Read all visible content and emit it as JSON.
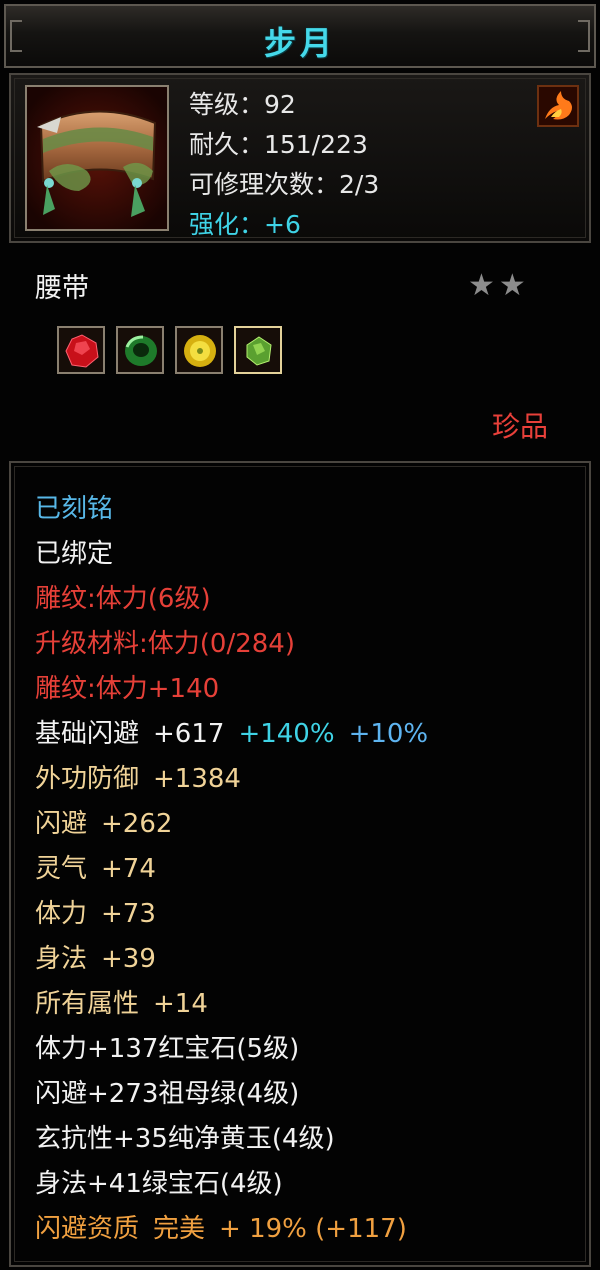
{
  "title": "步月",
  "header_stats": {
    "level": "等级：92",
    "durability": "耐久：151/223",
    "repair": "可修理次数：2/3",
    "enhance": "强化：+6"
  },
  "item_type": "腰带",
  "stars": "★★",
  "rarity": "珍品",
  "gem_icons": [
    "ruby-gem-icon",
    "emerald-ring-gem-icon",
    "yellow-jade-gem-icon",
    "green-gem-icon"
  ],
  "status": {
    "engraved": "已刻铭",
    "bound": "已绑定"
  },
  "carving": {
    "line1": "雕纹:体力(6级)",
    "line2": "升级材料:体力(0/284)",
    "line3": "雕纹:体力+140"
  },
  "base_dodge": {
    "label": "基础闪避",
    "value": "+617",
    "bonus1": "+140%",
    "bonus2": "+10%"
  },
  "attributes": [
    {
      "label": "外功防御",
      "value": "+1384"
    },
    {
      "label": "闪避",
      "value": "+262"
    },
    {
      "label": "灵气",
      "value": "+74"
    },
    {
      "label": "体力",
      "value": "+73"
    },
    {
      "label": "身法",
      "value": "+39"
    },
    {
      "label": "所有属性",
      "value": "+14"
    }
  ],
  "gem_stats": [
    "体力+137红宝石(5级)",
    "闪避+273祖母绿(4级)",
    "玄抗性+35纯净黄玉(4级)",
    "身法+41绿宝石(4级)"
  ],
  "aptitude": {
    "label": "闪避资质",
    "quality": "完美",
    "value": "+ 19% (+117)"
  },
  "colors": {
    "title": "#45d9ea",
    "enhance": "#3fd3e6",
    "engraved": "#58b8e8",
    "carving": "#e64038",
    "attribute": "#f0d398",
    "aptitude": "#f0a040",
    "rarity": "#e8403a"
  }
}
